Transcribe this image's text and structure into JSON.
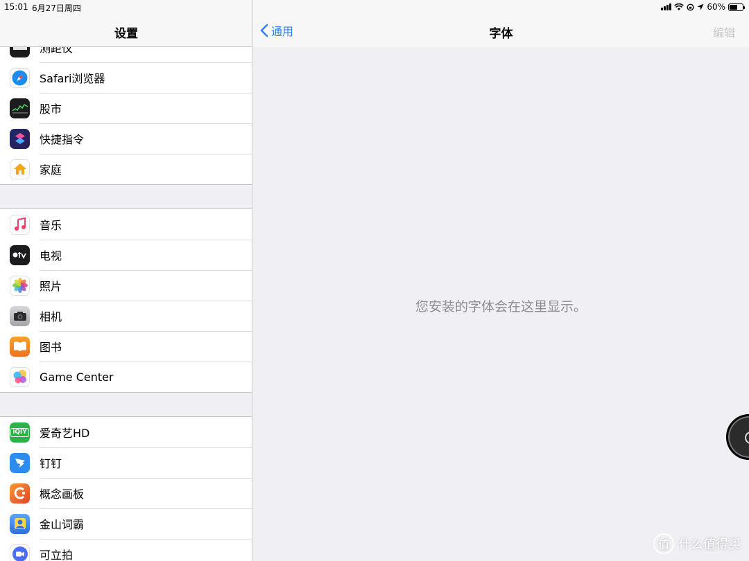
{
  "status_bar": {
    "time": "15:01",
    "date": "6月27日周四",
    "battery": "60%",
    "battery_level": 0.6
  },
  "settings_pane": {
    "title": "设置",
    "partial_item": "测距仪",
    "groups": [
      [
        {
          "label": "Safari浏览器",
          "icon": "safari-icon",
          "color": "#1d8cf0"
        },
        {
          "label": "股市",
          "icon": "stocks-icon",
          "color": "#1c1c1e"
        },
        {
          "label": "快捷指令",
          "icon": "shortcuts-icon",
          "color": "#3c3fb8"
        },
        {
          "label": "家庭",
          "icon": "home-icon",
          "color": "#ffffff"
        }
      ],
      [
        {
          "label": "音乐",
          "icon": "music-icon",
          "color": "#ffffff"
        },
        {
          "label": "电视",
          "icon": "tv-icon",
          "color": "#1c1c1e"
        },
        {
          "label": "照片",
          "icon": "photos-icon",
          "color": "#ffffff"
        },
        {
          "label": "相机",
          "icon": "camera-icon",
          "color": "#8e8e93"
        },
        {
          "label": "图书",
          "icon": "books-icon",
          "color": "#f08a24"
        },
        {
          "label": "Game Center",
          "icon": "game-center-icon",
          "color": "#ffffff"
        }
      ],
      [
        {
          "label": "爱奇艺HD",
          "icon": "iqiyi-icon",
          "color": "#2bb34a"
        },
        {
          "label": "钉钉",
          "icon": "dingtalk-icon",
          "color": "#2d8cf0"
        },
        {
          "label": "概念画板",
          "icon": "concepts-icon",
          "color": "#e8572d"
        },
        {
          "label": "金山词霸",
          "icon": "powerword-icon",
          "color": "#3e8cf5"
        },
        {
          "label": "可立拍",
          "icon": "clips-icon",
          "color": "#4a6cf6"
        }
      ]
    ]
  },
  "detail_pane": {
    "back_label": "通用",
    "title": "字体",
    "edit_label": "编辑",
    "empty_message": "您安装的字体会在这里显示。"
  },
  "watermark": {
    "logo": "值",
    "text": "什么值得买"
  },
  "colors": {
    "accent": "#2f7ff6",
    "disabled": "#c7c7cc",
    "secondary_text": "#8e8e93"
  }
}
